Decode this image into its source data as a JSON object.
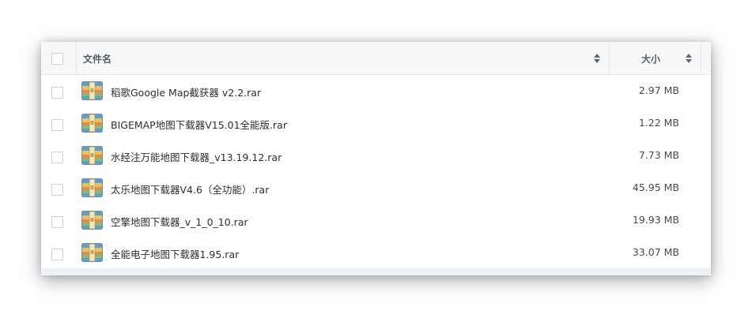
{
  "table": {
    "columns": {
      "name": "文件名",
      "size": "大小"
    },
    "rows": [
      {
        "name": "稻歌Google Map截获器 v2.2.rar",
        "size": "2.97 MB",
        "icon": "archive-icon"
      },
      {
        "name": "BIGEMAP地图下载器V15.01全能版.rar",
        "size": "1.22 MB",
        "icon": "archive-icon"
      },
      {
        "name": "水经注万能地图下载器_v13.19.12.rar",
        "size": "7.73 MB",
        "icon": "archive-icon"
      },
      {
        "name": "太乐地图下载器V4.6（全功能）.rar",
        "size": "45.95 MB",
        "icon": "archive-icon"
      },
      {
        "name": "空擎地图下载器_v_1_0_10.rar",
        "size": "19.93 MB",
        "icon": "archive-icon"
      },
      {
        "name": "全能电子地图下载器1.95.rar",
        "size": "33.07 MB",
        "icon": "archive-icon"
      }
    ]
  },
  "colors": {
    "header_bg": "#f7f8fa",
    "border": "#e4e6ea",
    "text": "#2b2f33"
  }
}
